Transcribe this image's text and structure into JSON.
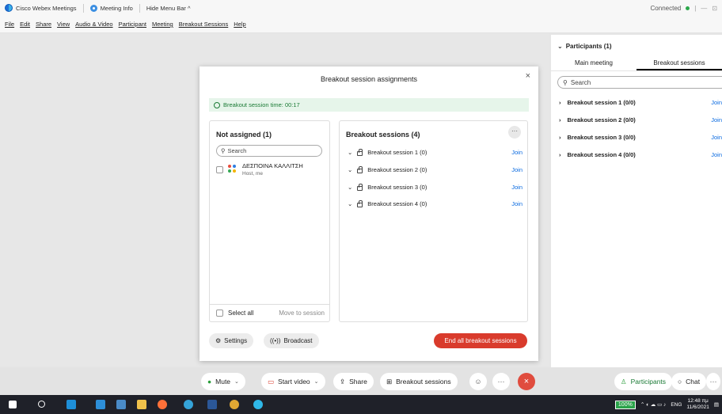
{
  "titlebar": {
    "app_name": "Cisco Webex Meetings",
    "meeting_info": "Meeting Info",
    "hide_menu": "Hide Menu Bar ^",
    "status": "Connected",
    "minimize": "—",
    "restore": "⊡"
  },
  "menu": [
    "File",
    "Edit",
    "Share",
    "View",
    "Audio & Video",
    "Participant",
    "Meeting",
    "Breakout Sessions",
    "Help"
  ],
  "dialog": {
    "title": "Breakout session assignments",
    "close": "×",
    "timer": "Breakout session time: 00:17",
    "not_assigned_title": "Not assigned (1)",
    "search_placeholder": "Search",
    "person_name": "ΔΕΣΠΟΙΝΑ ΚΑΛΛΙΤΣΗ",
    "person_role": "Host, me",
    "select_all": "Select all",
    "move_to_session": "Move to session",
    "sessions_title": "Breakout sessions  (4)",
    "more": "···",
    "sessions": [
      {
        "name": "Breakout session 1 (0)",
        "join": "Join"
      },
      {
        "name": "Breakout session 2 (0)",
        "join": "Join"
      },
      {
        "name": "Breakout session 3 (0)",
        "join": "Join"
      },
      {
        "name": "Breakout session 4 (0)",
        "join": "Join"
      }
    ],
    "settings": "Settings",
    "broadcast": "Broadcast",
    "end_all": "End all breakout sessions"
  },
  "panel": {
    "title": "Participants (1)",
    "tabs": [
      "Main meeting",
      "Breakout sessions"
    ],
    "search_placeholder": "Search",
    "rows": [
      {
        "name": "Breakout session 1 (0/0)",
        "join": "Join"
      },
      {
        "name": "Breakout session 2 (0/0)",
        "join": "Join"
      },
      {
        "name": "Breakout session 3 (0/0)",
        "join": "Join"
      },
      {
        "name": "Breakout session 4 (0/0)",
        "join": "Join"
      }
    ]
  },
  "controls": {
    "mute": "Mute",
    "start_video": "Start video",
    "share": "Share",
    "breakout": "Breakout sessions",
    "participants": "Participants",
    "chat": "Chat",
    "more": "···",
    "leave": "×"
  },
  "taskbar": {
    "battery": "100%",
    "lang": "ENG",
    "time": "12:48 πμ",
    "date": "11/6/2021"
  },
  "colors": {
    "accent_blue": "#0b6be0",
    "end_red": "#d93b2c",
    "timer_green": "#1a7a35"
  }
}
